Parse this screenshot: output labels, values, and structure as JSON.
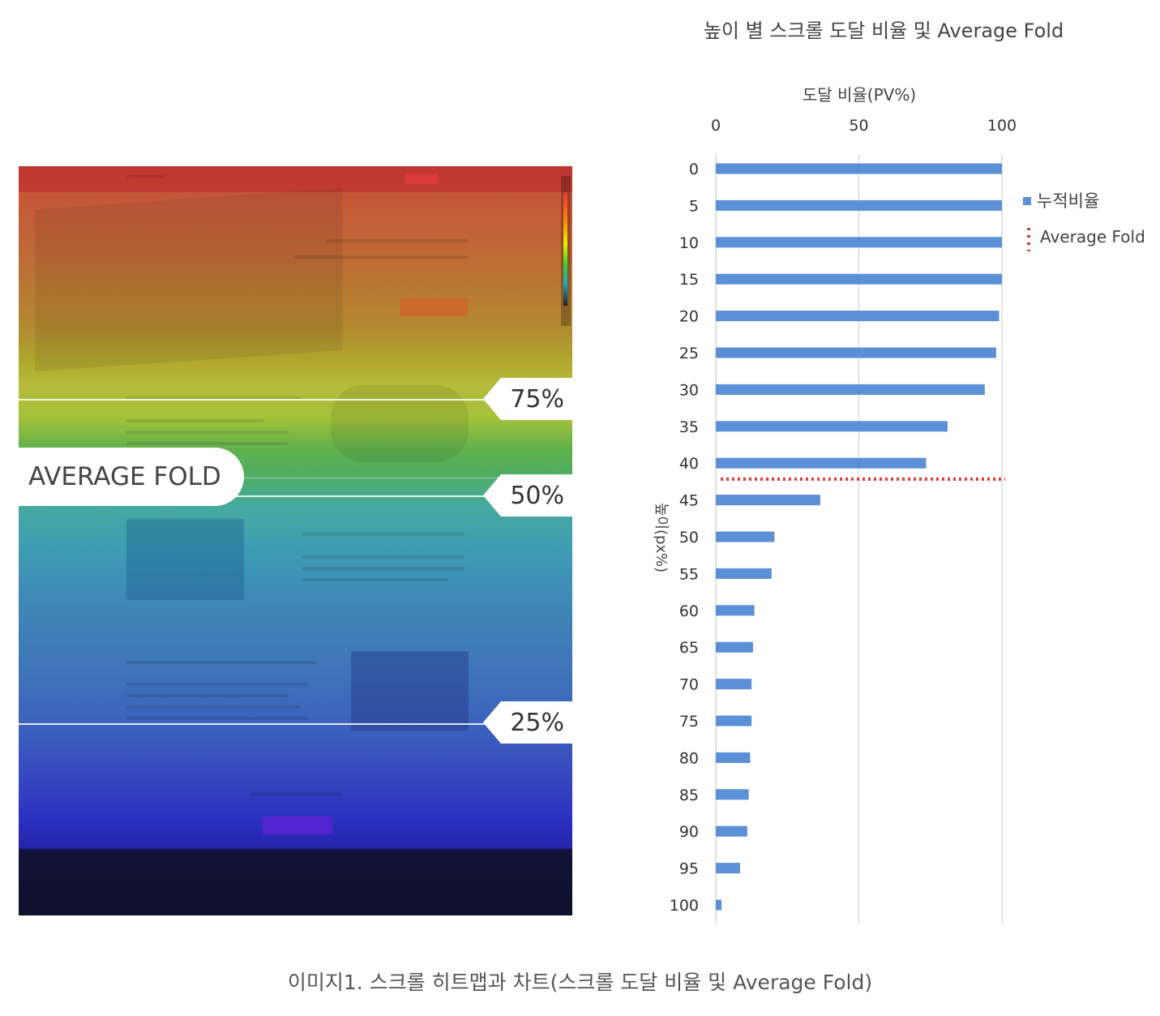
{
  "heatmap": {
    "markers": [
      {
        "label": "75%"
      },
      {
        "label": "50%"
      },
      {
        "label": "25%"
      }
    ],
    "average_fold_label": "AVERAGE FOLD"
  },
  "chart_data": {
    "type": "bar",
    "orientation": "horizontal",
    "title": "높이 별 스크롤 도달 비율 및 Average Fold",
    "xlabel": "도달 비율(PV%)",
    "ylabel": "높이(px%)",
    "xlim": [
      0,
      100
    ],
    "xticks": [
      "0",
      "50",
      "100"
    ],
    "categories": [
      "0",
      "5",
      "10",
      "15",
      "20",
      "25",
      "30",
      "35",
      "40",
      "45",
      "50",
      "55",
      "60",
      "65",
      "70",
      "75",
      "80",
      "85",
      "90",
      "95",
      "100"
    ],
    "series": [
      {
        "name": "누적비율",
        "color": "#5b8fd6",
        "values": [
          100,
          100,
          100,
          100,
          99,
          98,
          94,
          81,
          73.5,
          36.5,
          20.5,
          19.5,
          13.5,
          13,
          12.5,
          12.5,
          12,
          11.5,
          11,
          8.5,
          2
        ]
      }
    ],
    "average_fold": {
      "name": "Average Fold",
      "position": 42.5,
      "color": "#e03a3a"
    },
    "grid": true,
    "legend_position": "right"
  },
  "caption": "이미지1. 스크롤 히트맵과 차트(스크롤 도달 비율 및 Average Fold)"
}
